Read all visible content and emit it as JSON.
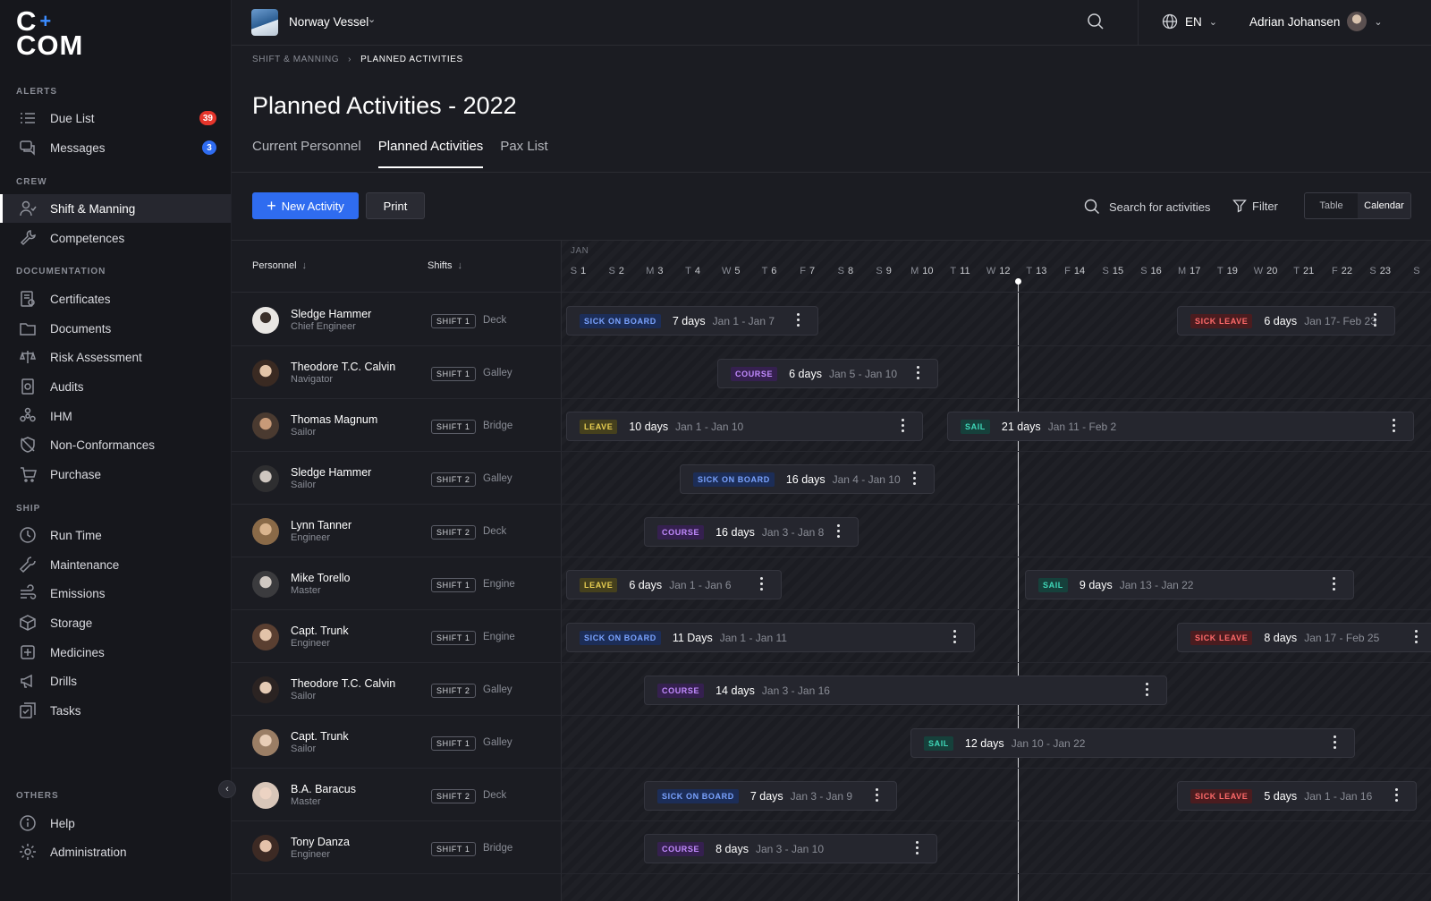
{
  "logo": {
    "line1": "C",
    "plus": "+",
    "line2": "COM"
  },
  "sidebar": {
    "sections": {
      "alerts": "ALERTS",
      "crew": "CREW",
      "documentation": "DOCUMENTATION",
      "ship": "SHIP",
      "others": "OTHERS"
    },
    "items": [
      {
        "label": "Due List",
        "icon": "list-icon",
        "badge": "39",
        "badge_color": "#e5352b"
      },
      {
        "label": "Messages",
        "icon": "chat-icon",
        "badge": "3",
        "badge_color": "#2f6cf0"
      },
      {
        "label": "Shift & Manning",
        "icon": "user-shift-icon",
        "active": true
      },
      {
        "label": "Competences",
        "icon": "wrench-icon"
      },
      {
        "label": "Certificates",
        "icon": "certificate-icon"
      },
      {
        "label": "Documents",
        "icon": "folder-icon"
      },
      {
        "label": "Risk Assessment",
        "icon": "scale-icon"
      },
      {
        "label": "Audits",
        "icon": "audit-icon"
      },
      {
        "label": "IHM",
        "icon": "hazard-icon"
      },
      {
        "label": "Non-Conformances",
        "icon": "shield-off-icon"
      },
      {
        "label": "Purchase",
        "icon": "cart-icon"
      },
      {
        "label": "Run Time",
        "icon": "clock-icon"
      },
      {
        "label": "Maintenance",
        "icon": "tool-icon"
      },
      {
        "label": "Emissions",
        "icon": "wind-icon"
      },
      {
        "label": "Storage",
        "icon": "box-icon"
      },
      {
        "label": "Medicines",
        "icon": "medical-icon"
      },
      {
        "label": "Drills",
        "icon": "megaphone-icon"
      },
      {
        "label": "Tasks",
        "icon": "tasks-icon"
      },
      {
        "label": "Help",
        "icon": "info-icon"
      },
      {
        "label": "Administration",
        "icon": "gear-icon"
      }
    ]
  },
  "topbar": {
    "vessel": "Norway Vessel",
    "language": "EN",
    "user": "Adrian Johansen"
  },
  "breadcrumb": {
    "parent": "SHIFT & MANNING",
    "current": "PLANNED ACTIVITIES"
  },
  "page": {
    "title": "Planned Activities - 2022"
  },
  "tabs": [
    "Current Personnel",
    "Planned Activities",
    "Pax List"
  ],
  "toolbar": {
    "new_activity": "New Activity",
    "print": "Print",
    "search_placeholder": "Search for activities",
    "filter": "Filter",
    "view_table": "Table",
    "view_calendar": "Calendar"
  },
  "grid": {
    "col_personnel": "Personnel",
    "col_shifts": "Shifts",
    "month": "JAN",
    "days": [
      {
        "w": "S",
        "d": "1"
      },
      {
        "w": "S",
        "d": "2"
      },
      {
        "w": "M",
        "d": "3"
      },
      {
        "w": "T",
        "d": "4"
      },
      {
        "w": "W",
        "d": "5"
      },
      {
        "w": "T",
        "d": "6"
      },
      {
        "w": "F",
        "d": "7"
      },
      {
        "w": "S",
        "d": "8"
      },
      {
        "w": "S",
        "d": "9"
      },
      {
        "w": "M",
        "d": "10"
      },
      {
        "w": "T",
        "d": "11"
      },
      {
        "w": "W",
        "d": "12"
      },
      {
        "w": "T",
        "d": "13"
      },
      {
        "w": "F",
        "d": "14"
      },
      {
        "w": "S",
        "d": "15"
      },
      {
        "w": "S",
        "d": "16"
      },
      {
        "w": "M",
        "d": "17"
      },
      {
        "w": "T",
        "d": "19"
      },
      {
        "w": "W",
        "d": "20"
      },
      {
        "w": "T",
        "d": "21"
      },
      {
        "w": "F",
        "d": "22"
      },
      {
        "w": "S",
        "d": "23"
      },
      {
        "w": "S",
        "d": ""
      }
    ],
    "rows": [
      {
        "name": "Sledge Hammer",
        "role": "Chief Engineer",
        "shift": "SHIFT 1",
        "area": "Deck",
        "activities": [
          {
            "type": "SICK ON BOARD",
            "days": "7 days",
            "dates": "Jan 1 - Jan 7"
          },
          {
            "type": "SICK LEAVE",
            "days": "6 days",
            "dates": "Jan 17- Feb 23"
          }
        ]
      },
      {
        "name": "Theodore T.C. Calvin",
        "role": "Navigator",
        "shift": "SHIFT 1",
        "area": "Galley",
        "activities": [
          {
            "type": "COURSE",
            "days": "6 days",
            "dates": "Jan 5 - Jan 10"
          }
        ]
      },
      {
        "name": "Thomas Magnum",
        "role": "Sailor",
        "shift": "SHIFT 1",
        "area": "Bridge",
        "activities": [
          {
            "type": "LEAVE",
            "days": "10 days",
            "dates": "Jan 1 - Jan 10"
          },
          {
            "type": "SAIL",
            "days": "21 days",
            "dates": "Jan 11 - Feb 2"
          }
        ]
      },
      {
        "name": "Sledge Hammer",
        "role": "Sailor",
        "shift": "SHIFT 2",
        "area": "Galley",
        "activities": [
          {
            "type": "SICK ON BOARD",
            "days": "16 days",
            "dates": "Jan 4 - Jan 10"
          }
        ]
      },
      {
        "name": "Lynn Tanner",
        "role": "Engineer",
        "shift": "SHIFT 2",
        "area": "Deck",
        "activities": [
          {
            "type": "COURSE",
            "days": "16 days",
            "dates": "Jan 3 - Jan 8"
          }
        ]
      },
      {
        "name": "Mike Torello",
        "role": "Master",
        "shift": "SHIFT 1",
        "area": "Engine",
        "activities": [
          {
            "type": "LEAVE",
            "days": "6 days",
            "dates": "Jan 1 - Jan 6"
          },
          {
            "type": "SAIL",
            "days": "9 days",
            "dates": "Jan 13 - Jan 22"
          }
        ]
      },
      {
        "name": "Capt. Trunk",
        "role": "Engineer",
        "shift": "SHIFT 1",
        "area": "Engine",
        "activities": [
          {
            "type": "SICK ON BOARD",
            "days": "11 Days",
            "dates": "Jan 1 - Jan 11"
          },
          {
            "type": "SICK LEAVE",
            "days": "8 days",
            "dates": "Jan 17 - Feb 25"
          }
        ]
      },
      {
        "name": "Theodore T.C. Calvin",
        "role": "Sailor",
        "shift": "SHIFT 2",
        "area": "Galley",
        "activities": [
          {
            "type": "COURSE",
            "days": "14 days",
            "dates": "Jan 3 - Jan 16"
          }
        ]
      },
      {
        "name": "Capt. Trunk",
        "role": "Sailor",
        "shift": "SHIFT 1",
        "area": "Galley",
        "activities": [
          {
            "type": "SAIL",
            "days": "12 days",
            "dates": "Jan 10 - Jan 22"
          }
        ]
      },
      {
        "name": "B.A. Baracus",
        "role": "Master",
        "shift": "SHIFT 2",
        "area": "Deck",
        "activities": [
          {
            "type": "SICK ON BOARD",
            "days": "7 days",
            "dates": "Jan 3 - Jan 9"
          },
          {
            "type": "SICK LEAVE",
            "days": "5 days",
            "dates": "Jan 1 - Jan 16"
          }
        ]
      },
      {
        "name": "Tony Danza",
        "role": "Engineer",
        "shift": "SHIFT 1",
        "area": "Bridge",
        "activities": [
          {
            "type": "COURSE",
            "days": "8 days",
            "dates": "Jan 3 - Jan 10"
          }
        ]
      }
    ]
  }
}
